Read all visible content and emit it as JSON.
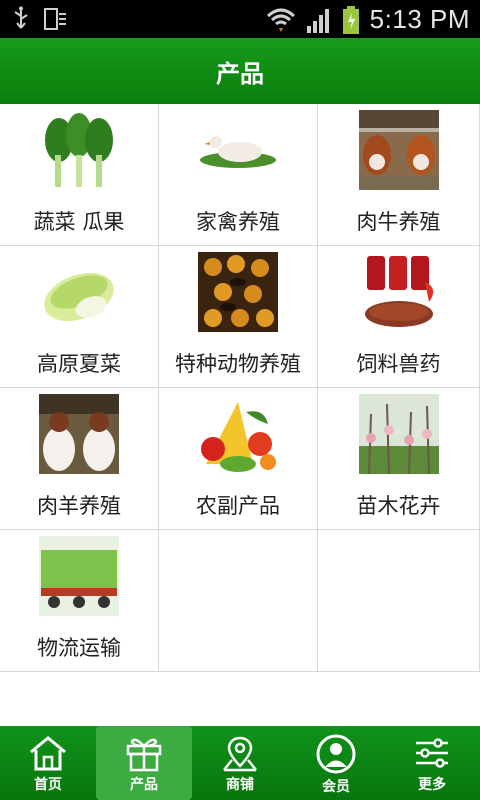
{
  "status_bar": {
    "time": "5:13 PM"
  },
  "header": {
    "title": "产品"
  },
  "products": [
    {
      "label": "蔬菜 瓜果",
      "icon": "vegetable-image"
    },
    {
      "label": "家禽养殖",
      "icon": "poultry-image"
    },
    {
      "label": "肉牛养殖",
      "icon": "cattle-image"
    },
    {
      "label": "高原夏菜",
      "icon": "cabbage-image"
    },
    {
      "label": "特种动物养殖",
      "icon": "bees-image"
    },
    {
      "label": "饲料兽药",
      "icon": "feed-image"
    },
    {
      "label": "肉羊养殖",
      "icon": "goats-image"
    },
    {
      "label": "农副产品",
      "icon": "produce-image"
    },
    {
      "label": "苗木花卉",
      "icon": "flowers-image"
    },
    {
      "label": "物流运输",
      "icon": "truck-image"
    }
  ],
  "nav": {
    "items": [
      {
        "label": "首页",
        "icon": "home-icon"
      },
      {
        "label": "产品",
        "icon": "gift-icon"
      },
      {
        "label": "商铺",
        "icon": "map-icon"
      },
      {
        "label": "会员",
        "icon": "member-icon"
      },
      {
        "label": "更多",
        "icon": "settings-icon"
      }
    ],
    "active_index": 1
  },
  "colors": {
    "header_green": "#0f8c12",
    "nav_green": "#0b8011",
    "nav_active": "#3bab42"
  }
}
